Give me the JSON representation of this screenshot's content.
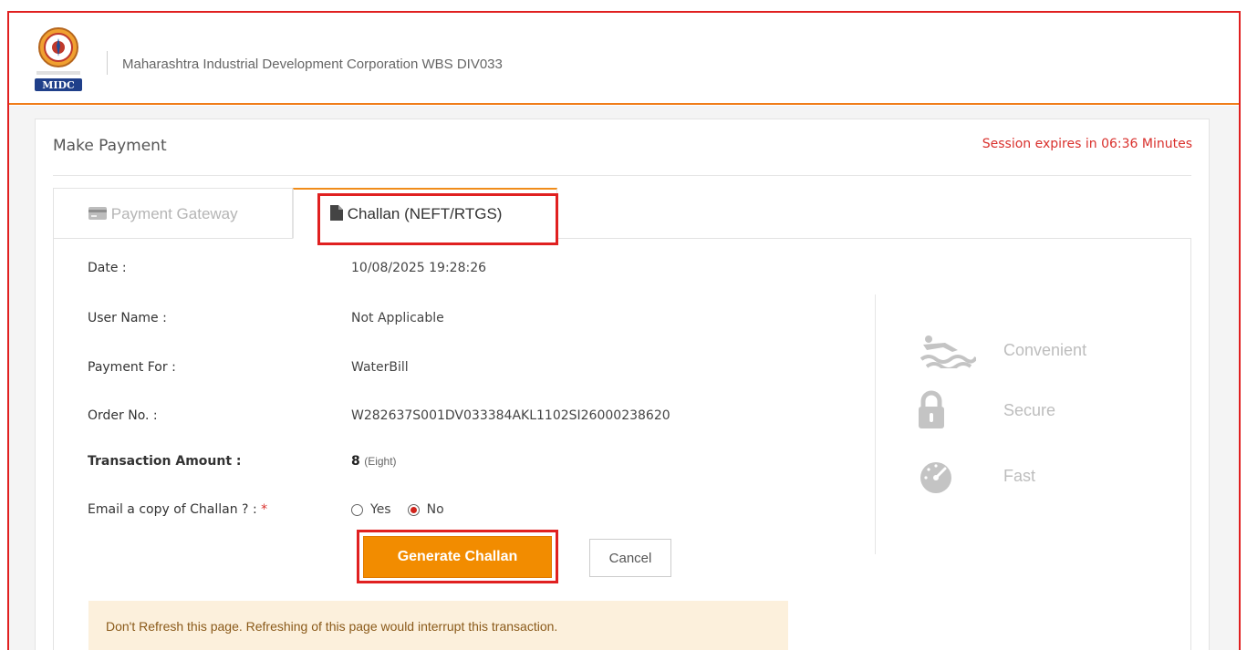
{
  "header": {
    "org_title": "Maharashtra Industrial Development Corporation WBS DIV033",
    "logo_icon": "midc-logo-icon",
    "logo_text": "MIDC"
  },
  "page": {
    "title": "Make Payment",
    "session_text": "Session expires in 06:36 Minutes"
  },
  "tabs": [
    {
      "label": "Payment Gateway",
      "icon": "credit-card-icon",
      "active": false
    },
    {
      "label": "Challan (NEFT/RTGS)",
      "icon": "document-icon",
      "active": true
    }
  ],
  "details": {
    "date_label": "Date :",
    "date_value": "10/08/2025 19:28:26",
    "user_label": "User Name :",
    "user_value": "Not Applicable",
    "payment_for_label": "Payment For :",
    "payment_for_value": "WaterBill",
    "order_label": "Order No. :",
    "order_value": "W282637S001DV033384AKL1102SI26000238620",
    "amount_label": "Transaction Amount :",
    "amount_value": "8",
    "amount_words": "(Eight)",
    "email_label": "Email a copy of Challan ? :",
    "email_required_mark": "*",
    "email_options": [
      {
        "label": "Yes",
        "checked": false
      },
      {
        "label": "No",
        "checked": true
      }
    ]
  },
  "actions": {
    "generate_label": "Generate Challan",
    "cancel_label": "Cancel"
  },
  "warning_text": "Don't Refresh this page. Refreshing of this page would interrupt this transaction.",
  "features": [
    {
      "label": "Convenient",
      "icon": "swimmer-icon"
    },
    {
      "label": "Secure",
      "icon": "lock-icon"
    },
    {
      "label": "Fast",
      "icon": "speedometer-icon"
    }
  ],
  "colors": {
    "accent_orange": "#f28c00",
    "header_rule": "#f07d1a",
    "highlight_red": "#e02020",
    "session_red": "#d9302c",
    "warning_bg": "#fcf0dc"
  }
}
